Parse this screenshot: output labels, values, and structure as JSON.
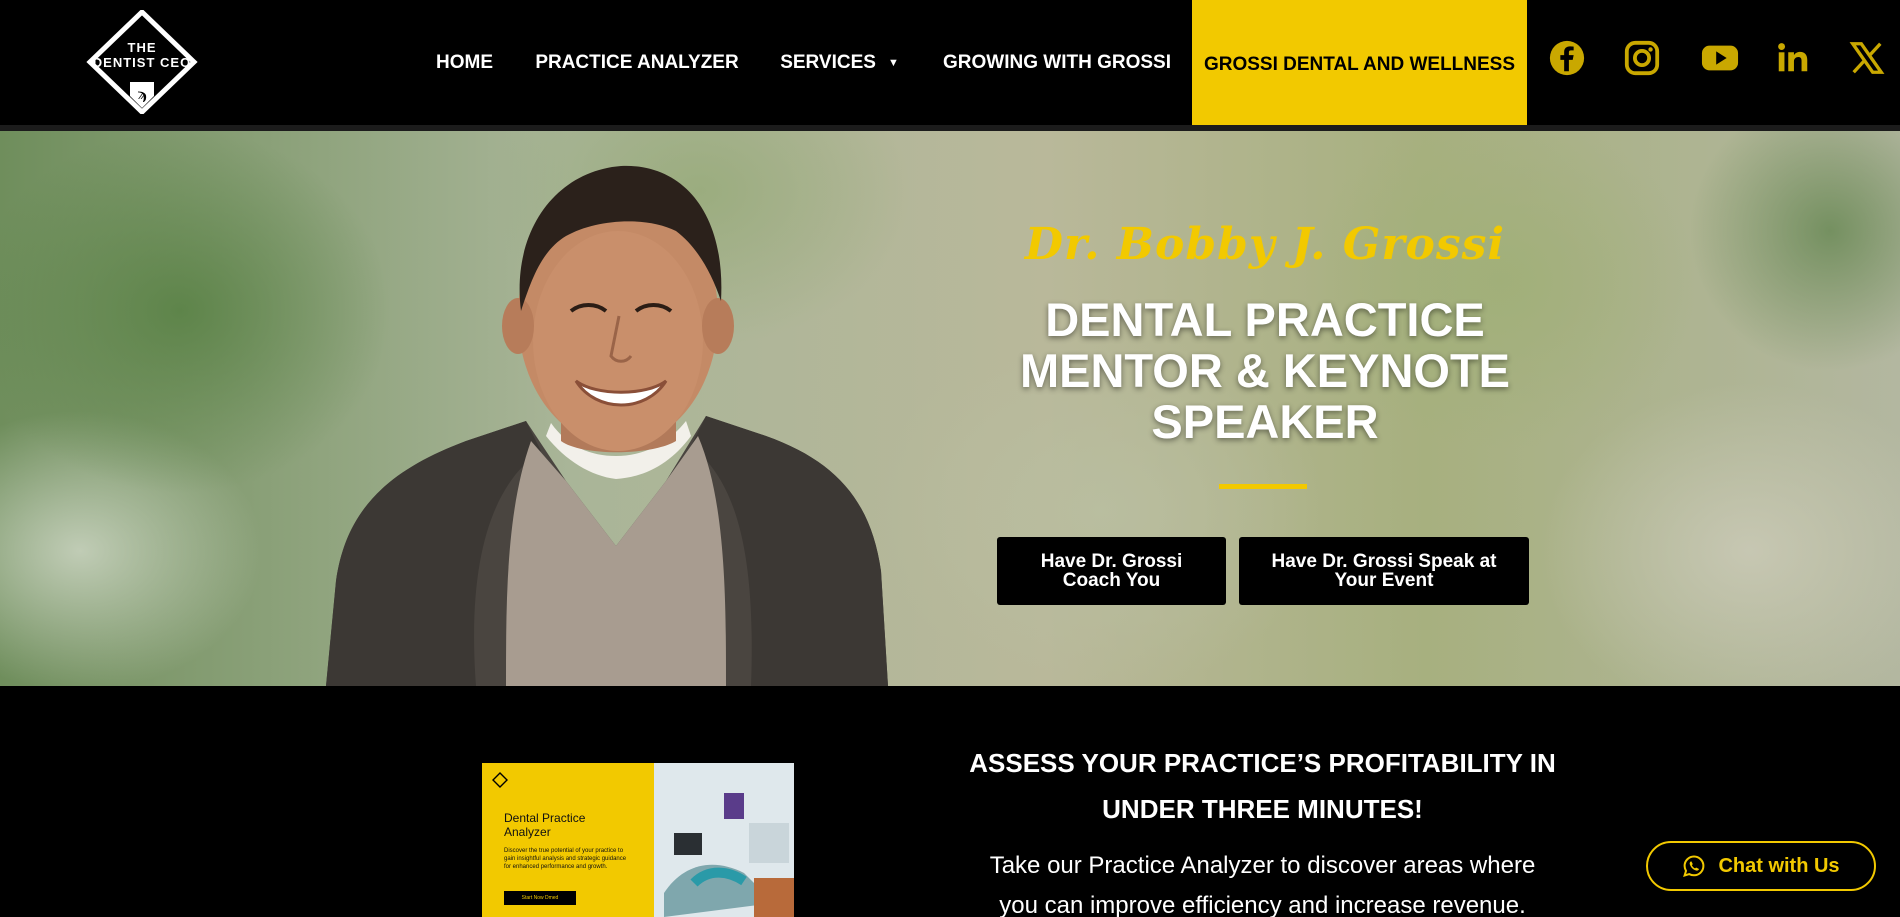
{
  "colors": {
    "accent": "#f2c900",
    "background": "#000000",
    "text": "#ffffff"
  },
  "logo": {
    "line1": "THE",
    "line2": "DENTIST CEO",
    "icon": "diamond-monogram-logo"
  },
  "nav": {
    "items": [
      {
        "label": "HOME"
      },
      {
        "label": "PRACTICE ANALYZER"
      },
      {
        "label": "SERVICES"
      },
      {
        "label": "GROWING WITH GROSSI"
      },
      {
        "label": "GROSSI DENTAL AND WELLNESS"
      }
    ],
    "services_dropdown_icon": "caret-down-icon",
    "caret_glyph": "▼"
  },
  "social": [
    {
      "name": "facebook-icon"
    },
    {
      "name": "instagram-icon"
    },
    {
      "name": "youtube-icon"
    },
    {
      "name": "linkedin-icon"
    },
    {
      "name": "x-icon"
    }
  ],
  "hero": {
    "script_name": "Dr. Bobby J. Grossi",
    "title_line1": "DENTAL PRACTICE",
    "title_line2": "MENTOR & KEYNOTE",
    "title_line3": "SPEAKER",
    "button_coach_line1": "Have Dr. Grossi",
    "button_coach_line2": "Coach You",
    "button_speak_line1": "Have Dr. Grossi Speak at",
    "button_speak_line2": "Your Event"
  },
  "analyzer": {
    "card_title_line1": "Dental Practice",
    "card_title_line2": "Analyzer",
    "card_desc": "Discover the true potential of your practice to gain insightful analysis and strategic guidance for enhanced performance and growth.",
    "card_button": "Start Now Dmed",
    "heading_line1": "ASSESS YOUR PRACTICE’S PROFITABILITY IN",
    "heading_line2": "UNDER THREE MINUTES!",
    "text_line1": "Take our Practice Analyzer to discover areas where",
    "text_line2": "you can improve efficiency and increase revenue."
  },
  "chat": {
    "label": "Chat with Us",
    "icon": "whatsapp-icon"
  }
}
